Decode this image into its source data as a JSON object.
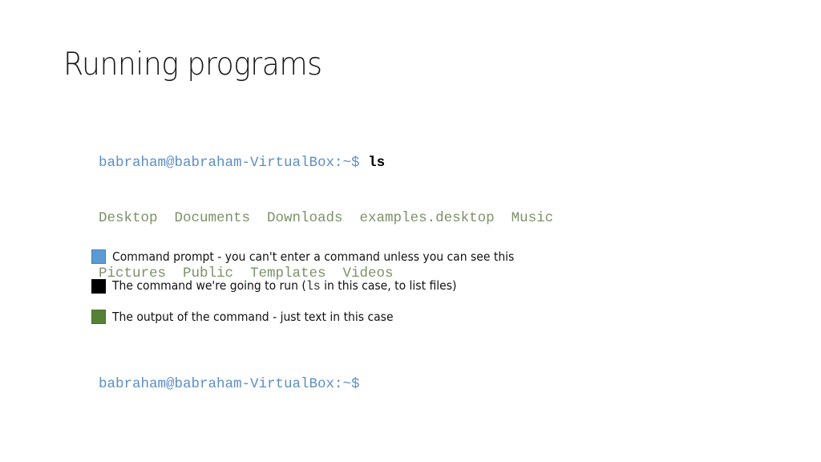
{
  "title": "Running programs",
  "terminal": {
    "prompt": "babraham@babraham-VirtualBox:~$",
    "command": "ls",
    "output_lines": [
      "Desktop  Documents  Downloads  examples.desktop  Music",
      "Pictures  Public  Templates  Videos"
    ],
    "second_prompt": "babraham@babraham-VirtualBox:~$"
  },
  "legend": [
    {
      "color": "#5b9bd5",
      "text": "Command prompt - you can't enter a command unless you can see this"
    },
    {
      "color": "#000000",
      "text_before": "The command we're going to run (",
      "code": "ls",
      "text_after": " in this case, to list files)"
    },
    {
      "color": "#548235",
      "text": "The output of the command - just text in this case"
    }
  ]
}
